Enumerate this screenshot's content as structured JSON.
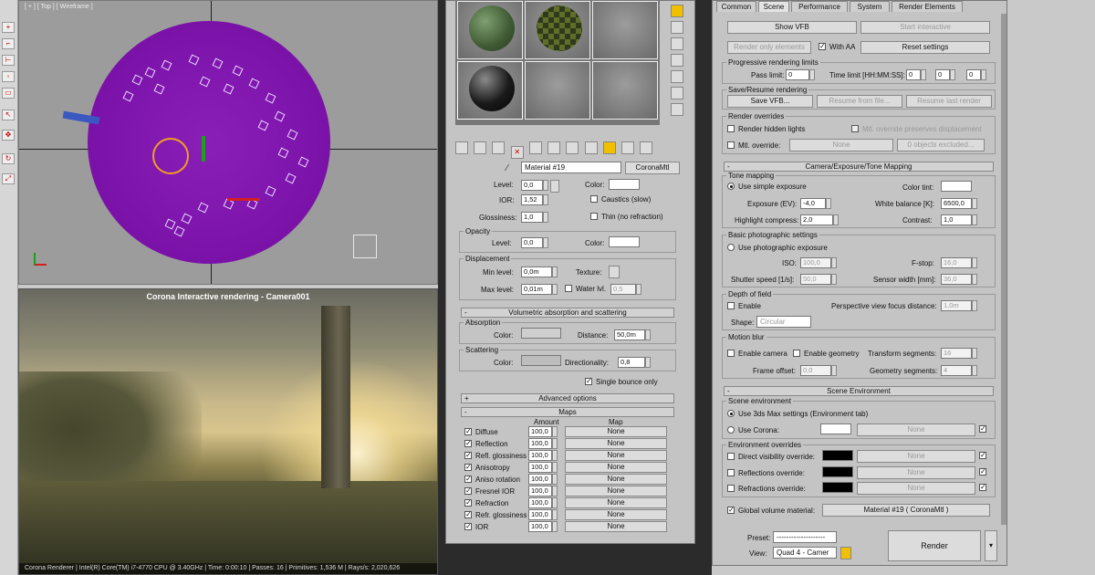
{
  "viewport_top": {
    "label": "[ + ] [ Top ] [ Wireframe ]"
  },
  "viewport_render": {
    "title": "Corona Interactive rendering - Camera001",
    "status": "Corona Renderer | Intel(R) Core(TM) i7-4770 CPU @ 3.40GHz | Time: 0:00:10 | Passes: 16 | Primitives: 1,536 M | Rays/s: 2,020,626"
  },
  "material_editor": {
    "material_name": "Material #19",
    "material_type": "CoronaMtl",
    "refraction": {
      "level_label": "Level:",
      "level": "0,0",
      "color_label": "Color:",
      "ior_label": "IOR:",
      "ior": "1,52",
      "caustics_label": "Caustics (slow)",
      "glossiness_label": "Glossiness:",
      "glossiness": "1,0",
      "thin_label": "Thin (no refraction)"
    },
    "opacity": {
      "title": "Opacity",
      "level_label": "Level:",
      "level": "0,0",
      "color_label": "Color:"
    },
    "displacement": {
      "title": "Displacement",
      "min_label": "Min level:",
      "min": "0,0m",
      "texture_label": "Texture:",
      "max_label": "Max level:",
      "max": "0,01m",
      "water_label": "Water lvl.",
      "water": "0,5"
    },
    "volumetric_rollout": "Volumetric absorption and scattering",
    "absorption": {
      "title": "Absorption",
      "color_label": "Color:",
      "distance_label": "Distance:",
      "distance": "50,0m"
    },
    "scattering": {
      "title": "Scattering",
      "color_label": "Color:",
      "directionality_label": "Directionality:",
      "directionality": "0,8",
      "single_bounce_label": "Single bounce only"
    },
    "advanced_rollout": "Advanced options",
    "maps_rollout": "Maps",
    "maps_header": {
      "amount": "Amount",
      "map": "Map"
    },
    "maps": [
      {
        "name": "Diffuse",
        "amount": "100,0",
        "map": "None"
      },
      {
        "name": "Reflection",
        "amount": "100,0",
        "map": "None"
      },
      {
        "name": "Refl. glossiness",
        "amount": "100,0",
        "map": "None"
      },
      {
        "name": "Anisotropy",
        "amount": "100,0",
        "map": "None"
      },
      {
        "name": "Aniso rotation",
        "amount": "100,0",
        "map": "None"
      },
      {
        "name": "Fresnel IOR",
        "amount": "100,0",
        "map": "None"
      },
      {
        "name": "Refraction",
        "amount": "100,0",
        "map": "None"
      },
      {
        "name": "Refr. glossiness",
        "amount": "100,0",
        "map": "None"
      },
      {
        "name": "IOR",
        "amount": "100,0",
        "map": "None"
      }
    ]
  },
  "render_setup": {
    "tabs": [
      {
        "label": "Common"
      },
      {
        "label": "Scene"
      },
      {
        "label": "Performance"
      },
      {
        "label": "System"
      },
      {
        "label": "Render Elements"
      }
    ],
    "show_vfb": "Show VFB",
    "start_interactive": "Start interactive",
    "render_only_elements": "Render only elements",
    "with_aa": "With AA",
    "reset_settings": "Reset settings",
    "progressive": {
      "title": "Progressive rendering limits",
      "pass_limit_label": "Pass limit:",
      "pass_limit": "0",
      "time_limit_label": "Time limit [HH:MM:SS]:",
      "time_h": "0",
      "time_m": "0",
      "time_s": "0"
    },
    "save_resume": {
      "title": "Save/Resume rendering",
      "save_vfb": "Save VFB...",
      "resume_file": "Resume from file...",
      "resume_last": "Resume last render"
    },
    "overrides": {
      "title": "Render overrides",
      "hidden_lights": "Render hidden lights",
      "preserve_disp": "Mtl. override preserves displacement",
      "mtl_override": "Mtl. override:",
      "mtl_none": "None",
      "excluded": "0 objects excluded..."
    },
    "camera_rollout": "Camera/Exposure/Tone Mapping",
    "tone_mapping": {
      "title": "Tone mapping",
      "simple": "Use simple exposure",
      "color_tint_label": "Color tint:",
      "exposure_label": "Exposure (EV):",
      "exposure": "-4,0",
      "white_balance_label": "White balance [K]:",
      "white_balance": "6500,0",
      "highlight_label": "Highlight compress:",
      "highlight": "2,0",
      "contrast_label": "Contrast:",
      "contrast": "1,0"
    },
    "photographic": {
      "title": "Basic photographic settings",
      "use_photo": "Use photographic exposure",
      "iso_label": "ISO:",
      "iso": "100,0",
      "fstop_label": "F-stop:",
      "fstop": "16,0",
      "shutter_label": "Shutter speed [1/s]:",
      "shutter": "50,0",
      "sensor_label": "Sensor width [mm]:",
      "sensor": "36,0"
    },
    "dof": {
      "title": "Depth of field",
      "enable": "Enable",
      "focus_label": "Perspective view focus distance:",
      "focus": "1,0m",
      "shape_label": "Shape:",
      "shape": "Circular"
    },
    "motion_blur": {
      "title": "Motion blur",
      "enable_camera": "Enable camera",
      "enable_geometry": "Enable geometry",
      "transform_label": "Transform segments:",
      "transform": "16",
      "frame_offset_label": "Frame offset:",
      "frame_offset": "0,0",
      "geometry_label": "Geometry segments:",
      "geometry": "4"
    },
    "scene_env_rollout": "Scene Environment",
    "scene_env": {
      "title": "Scene environment",
      "use_3ds": "Use 3ds Max settings (Environment tab)",
      "use_corona": "Use Corona:",
      "corona_map": "None"
    },
    "env_overrides": {
      "title": "Environment overrides",
      "direct": "Direct visibility override:",
      "reflections": "Reflections override:",
      "refractions": "Refractions override:",
      "none": "None"
    },
    "global_volume_label": "Global volume material:",
    "global_volume": "Material #19  ( CoronaMtl )",
    "preset_label": "Preset:",
    "preset": "--------------------",
    "view_label": "View:",
    "view": "Quad 4 - Camer",
    "render_button": "Render"
  },
  "colors": {
    "disc": "#7a12a8",
    "accent": "#f0c000",
    "sun": "#f0a020"
  }
}
